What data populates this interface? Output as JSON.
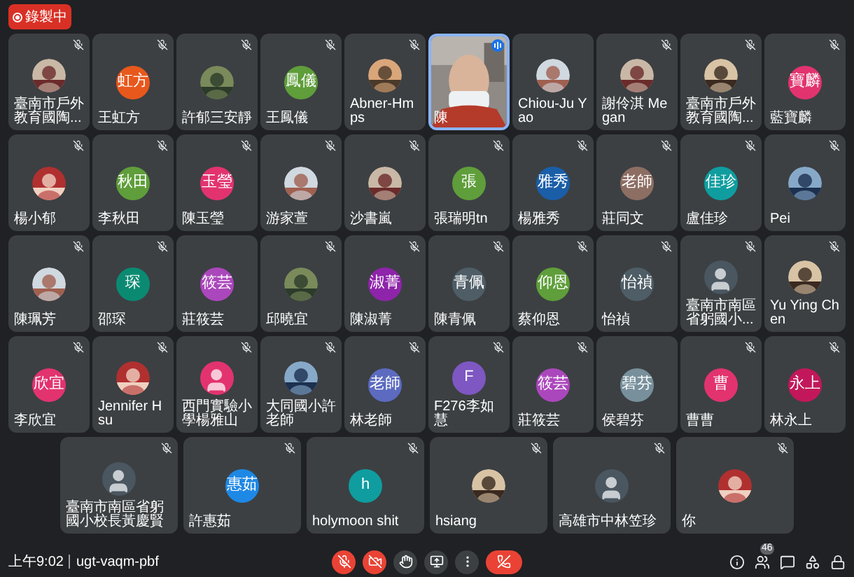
{
  "recording": {
    "label": "錄製中"
  },
  "rows": [
    {
      "tiles": [
        {
          "name": "臺南市戶外教育國陶...",
          "muted": true,
          "speaking": false
        },
        {
          "name": "王虹方",
          "avatar": {
            "kind": "initials",
            "text": "虹方",
            "color": "#e8581c"
          },
          "muted": true,
          "speaking": false
        },
        {
          "name": "許郁三安靜",
          "muted": true,
          "speaking": false
        },
        {
          "name": "王鳳儀",
          "avatar": {
            "kind": "initials",
            "text": "鳳儀",
            "color": "#5f9e3a"
          },
          "muted": true,
          "speaking": false
        },
        {
          "name": "Abner-Hmps",
          "muted": true,
          "speaking": false
        },
        {
          "name": "陳",
          "avatar": {
            "kind": "video"
          },
          "muted": false,
          "speaking": true
        },
        {
          "name": "Chiou-Ju Yao",
          "muted": false,
          "speaking": false
        },
        {
          "name": "謝伶淇 Megan",
          "muted": true,
          "speaking": false
        },
        {
          "name": "臺南市戶外教育國陶...",
          "muted": true,
          "speaking": false
        },
        {
          "name": "藍寶麟",
          "avatar": {
            "kind": "initials",
            "text": "寶麟",
            "color": "#e2336f"
          },
          "muted": true,
          "speaking": false
        }
      ]
    },
    {
      "tiles": [
        {
          "name": "楊小郁",
          "muted": true,
          "speaking": false
        },
        {
          "name": "李秋田",
          "avatar": {
            "kind": "initials",
            "text": "秋田",
            "color": "#5f9e3a"
          },
          "muted": true,
          "speaking": false
        },
        {
          "name": "陳玉瑩",
          "avatar": {
            "kind": "initials",
            "text": "玉瑩",
            "color": "#e2336f"
          },
          "muted": true,
          "speaking": false
        },
        {
          "name": "游家萱",
          "muted": true,
          "speaking": false
        },
        {
          "name": "沙書嵐",
          "muted": true,
          "speaking": false
        },
        {
          "name": "張瑞明tn",
          "avatar": {
            "kind": "initials",
            "text": "張",
            "color": "#5f9e3a"
          },
          "muted": true,
          "speaking": false
        },
        {
          "name": "楊雅秀",
          "avatar": {
            "kind": "initials",
            "text": "雅秀",
            "color": "#1a5ea8"
          },
          "muted": true,
          "speaking": false
        },
        {
          "name": "莊同文",
          "avatar": {
            "kind": "initials",
            "text": "老師",
            "color": "#8d6e63"
          },
          "muted": true,
          "speaking": false
        },
        {
          "name": "盧佳珍",
          "avatar": {
            "kind": "initials",
            "text": "佳珍",
            "color": "#0f9d9f"
          },
          "muted": true,
          "speaking": false
        },
        {
          "name": "Pei",
          "muted": true,
          "speaking": false
        }
      ]
    },
    {
      "tiles": [
        {
          "name": "陳珮芳",
          "muted": true,
          "speaking": false
        },
        {
          "name": "邵琛",
          "avatar": {
            "kind": "initials",
            "text": "琛",
            "color": "#0b8a72"
          },
          "muted": true,
          "speaking": false
        },
        {
          "name": "莊筱芸",
          "avatar": {
            "kind": "initials",
            "text": "筱芸",
            "color": "#ab47bc"
          },
          "muted": false,
          "speaking": false
        },
        {
          "name": "邱曉宜",
          "muted": true,
          "speaking": false
        },
        {
          "name": "陳淑菁",
          "avatar": {
            "kind": "initials",
            "text": "淑菁",
            "color": "#8e24aa"
          },
          "muted": true,
          "speaking": false
        },
        {
          "name": "陳青佩",
          "avatar": {
            "kind": "initials",
            "text": "青佩",
            "color": "#4e5d66"
          },
          "muted": true,
          "speaking": false
        },
        {
          "name": "蔡仰恩",
          "avatar": {
            "kind": "initials",
            "text": "仰恩",
            "color": "#5f9e3a"
          },
          "muted": true,
          "speaking": false
        },
        {
          "name": "怡禎",
          "avatar": {
            "kind": "initials",
            "text": "怡禎",
            "color": "#4e5d66"
          },
          "muted": true,
          "speaking": false
        },
        {
          "name": "臺南市南區省躬國小...",
          "avatar": {
            "kind": "generic"
          },
          "muted": true,
          "speaking": false
        },
        {
          "name": "Yu Ying Chen",
          "muted": true,
          "speaking": false
        }
      ]
    },
    {
      "tiles": [
        {
          "name": "李欣宜",
          "avatar": {
            "kind": "initials",
            "text": "欣宜",
            "color": "#e2336f"
          },
          "muted": true,
          "speaking": false
        },
        {
          "name": "Jennifer Hsu",
          "muted": true,
          "speaking": false
        },
        {
          "name": "西門實驗小學楊雅山",
          "avatar": {
            "kind": "generic_pink"
          },
          "muted": true,
          "speaking": false
        },
        {
          "name": "大同國小許老師",
          "muted": true,
          "speaking": false
        },
        {
          "name": "林老師",
          "avatar": {
            "kind": "initials",
            "text": "老師",
            "color": "#5c6bc0"
          },
          "muted": true,
          "speaking": false
        },
        {
          "name": "F276李如慧",
          "avatar": {
            "kind": "initials",
            "text": "F",
            "color": "#7e57c2"
          },
          "muted": true,
          "speaking": false
        },
        {
          "name": "莊筱芸",
          "avatar": {
            "kind": "initials",
            "text": "筱芸",
            "color": "#ab47bc"
          },
          "muted": true,
          "speaking": false
        },
        {
          "name": "侯碧芬",
          "avatar": {
            "kind": "initials",
            "text": "碧芬",
            "color": "#78909c"
          },
          "muted": false,
          "speaking": false
        },
        {
          "name": "曹曹",
          "avatar": {
            "kind": "initials",
            "text": "曹",
            "color": "#e2336f"
          },
          "muted": true,
          "speaking": false
        },
        {
          "name": "林永上",
          "avatar": {
            "kind": "initials",
            "text": "永上",
            "color": "#c2185b"
          },
          "muted": true,
          "speaking": false
        }
      ]
    },
    {
      "tiles": [
        {
          "name": "臺南市南區省躬國小校長黃慶賢",
          "avatar": {
            "kind": "generic"
          },
          "muted": true,
          "speaking": false
        },
        {
          "name": "許惠茹",
          "avatar": {
            "kind": "initials",
            "text": "惠茹",
            "color": "#1e88e5"
          },
          "muted": true,
          "speaking": false
        },
        {
          "name": "holymoon shit",
          "avatar": {
            "kind": "initials",
            "text": "h",
            "color": "#0f9d9f"
          },
          "muted": true,
          "speaking": false
        },
        {
          "name": "hsiang",
          "muted": true,
          "speaking": false
        },
        {
          "name": "高雄市中林笠珍",
          "avatar": {
            "kind": "generic"
          },
          "muted": true,
          "speaking": false
        },
        {
          "name": "你",
          "muted": true,
          "speaking": false
        }
      ]
    }
  ],
  "bottom_bar": {
    "time": "上午9:02",
    "meeting_code": "ugt-vaqm-pbf",
    "mic_on": false,
    "camera_on": false,
    "controls": [
      {
        "kind": "mic"
      },
      {
        "kind": "camera"
      },
      {
        "kind": "hand"
      },
      {
        "kind": "present"
      },
      {
        "kind": "more"
      },
      {
        "kind": "end"
      }
    ],
    "people_count": "46"
  }
}
